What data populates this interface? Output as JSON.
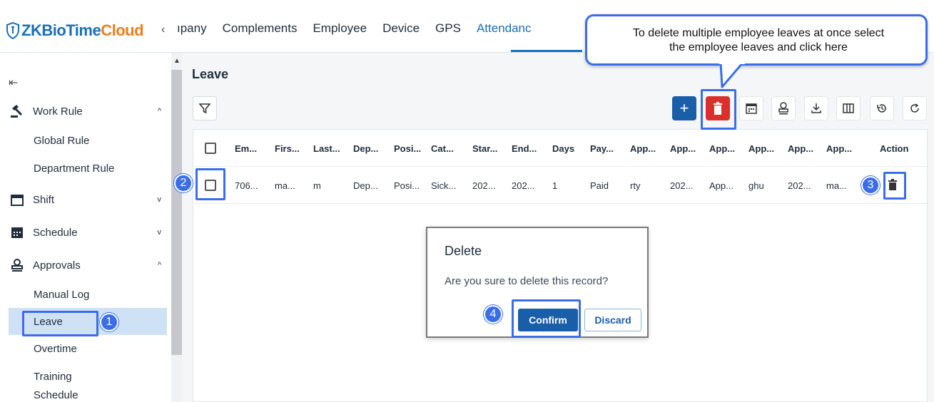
{
  "header": {
    "logo_zk": "ZKBioTime",
    "logo_cloud": "Cloud",
    "nav_prev": "‹",
    "tabs": [
      "ıpany",
      "Complements",
      "Employee",
      "Device",
      "GPS",
      "Attendanc"
    ]
  },
  "sidebar": {
    "groups": [
      {
        "label": "Work Rule",
        "icon": "gavel-icon",
        "chevron": "^"
      },
      {
        "label": "Shift",
        "icon": "calendar-icon",
        "chevron": "v"
      },
      {
        "label": "Schedule",
        "icon": "calendar-grid-icon",
        "chevron": "v"
      },
      {
        "label": "Approvals",
        "icon": "stamp-icon",
        "chevron": "^"
      }
    ],
    "items": [
      "Global Rule",
      "Department Rule",
      "Manual Log",
      "Leave",
      "Overtime",
      "Training",
      "Schedule"
    ]
  },
  "page": {
    "title": "Leave"
  },
  "table": {
    "headers": [
      "Em...",
      "Firs...",
      "Last...",
      "Dep...",
      "Posi...",
      "Cat...",
      "Star...",
      "End...",
      "Days",
      "Pay...",
      "App...",
      "App...",
      "App...",
      "App...",
      "App...",
      "App...",
      "Action"
    ],
    "row": [
      "706...",
      "ma...",
      "m",
      "Dep...",
      "Posi...",
      "Sick...",
      "202...",
      "202...",
      "1",
      "Paid",
      "rty",
      "202...",
      "App...",
      "ghu",
      "202...",
      "ma..."
    ]
  },
  "dialog": {
    "title": "Delete",
    "message": "Are you sure to delete this record?",
    "confirm": "Confirm",
    "discard": "Discard"
  },
  "annotations": {
    "callout_line1": "To delete multiple employee leaves at once select",
    "callout_line2": "the employee leaves and click here",
    "badges": [
      "1",
      "2",
      "3",
      "4"
    ],
    "accent": "#3a6ee8"
  },
  "colors": {
    "primary": "#1a5ea8",
    "danger": "#d9302c",
    "brand_orange": "#f07d1a"
  }
}
